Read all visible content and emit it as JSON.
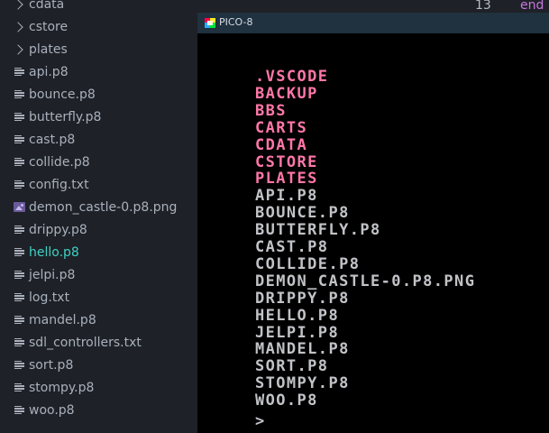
{
  "sidebar": {
    "items": [
      {
        "type": "folder",
        "label": "cdata",
        "icon": "chevron-right-icon"
      },
      {
        "type": "folder",
        "label": "cstore",
        "icon": "chevron-right-icon"
      },
      {
        "type": "folder",
        "label": "plates",
        "icon": "chevron-right-icon"
      },
      {
        "type": "file",
        "label": "api.p8",
        "icon": "file-lines-icon"
      },
      {
        "type": "file",
        "label": "bounce.p8",
        "icon": "file-lines-icon"
      },
      {
        "type": "file",
        "label": "butterfly.p8",
        "icon": "file-lines-icon"
      },
      {
        "type": "file",
        "label": "cast.p8",
        "icon": "file-lines-icon"
      },
      {
        "type": "file",
        "label": "collide.p8",
        "icon": "file-lines-icon"
      },
      {
        "type": "file",
        "label": "config.txt",
        "icon": "file-lines-icon"
      },
      {
        "type": "image",
        "label": "demon_castle-0.p8.png",
        "icon": "image-file-icon"
      },
      {
        "type": "file",
        "label": "drippy.p8",
        "icon": "file-lines-icon"
      },
      {
        "type": "file",
        "label": "hello.p8",
        "icon": "file-lines-icon",
        "active": true
      },
      {
        "type": "file",
        "label": "jelpi.p8",
        "icon": "file-lines-icon"
      },
      {
        "type": "file",
        "label": "log.txt",
        "icon": "file-lines-icon"
      },
      {
        "type": "file",
        "label": "mandel.p8",
        "icon": "file-lines-icon"
      },
      {
        "type": "file",
        "label": "sdl_controllers.txt",
        "icon": "file-lines-icon"
      },
      {
        "type": "file",
        "label": "sort.p8",
        "icon": "file-lines-icon"
      },
      {
        "type": "file",
        "label": "stompy.p8",
        "icon": "file-lines-icon"
      },
      {
        "type": "file",
        "label": "woo.p8",
        "icon": "file-lines-icon"
      }
    ]
  },
  "editor": {
    "line_number": "13",
    "keyword": "end"
  },
  "pico": {
    "title": "PICO-8",
    "listing": [
      {
        "text": ".vscode",
        "kind": "dir"
      },
      {
        "text": "backup",
        "kind": "dir"
      },
      {
        "text": "bbs",
        "kind": "dir"
      },
      {
        "text": "carts",
        "kind": "dir"
      },
      {
        "text": "cdata",
        "kind": "dir"
      },
      {
        "text": "cstore",
        "kind": "dir"
      },
      {
        "text": "plates",
        "kind": "dir"
      },
      {
        "text": "api.p8",
        "kind": "file"
      },
      {
        "text": "bounce.p8",
        "kind": "file"
      },
      {
        "text": "butterfly.p8",
        "kind": "file"
      },
      {
        "text": "cast.p8",
        "kind": "file"
      },
      {
        "text": "collide.p8",
        "kind": "file"
      },
      {
        "text": "demon_castle-0.p8.png",
        "kind": "file"
      },
      {
        "text": "drippy.p8",
        "kind": "file"
      },
      {
        "text": "hello.p8",
        "kind": "file"
      },
      {
        "text": "jelpi.p8",
        "kind": "file"
      },
      {
        "text": "mandel.p8",
        "kind": "file"
      },
      {
        "text": "sort.p8",
        "kind": "file"
      },
      {
        "text": "stompy.p8",
        "kind": "file"
      },
      {
        "text": "woo.p8",
        "kind": "file"
      }
    ],
    "prompt": ">"
  },
  "colors": {
    "dir": "#ff77a8",
    "file": "#c2c3c7",
    "active": "#3fd1c4",
    "titlebar": "#20313f"
  }
}
